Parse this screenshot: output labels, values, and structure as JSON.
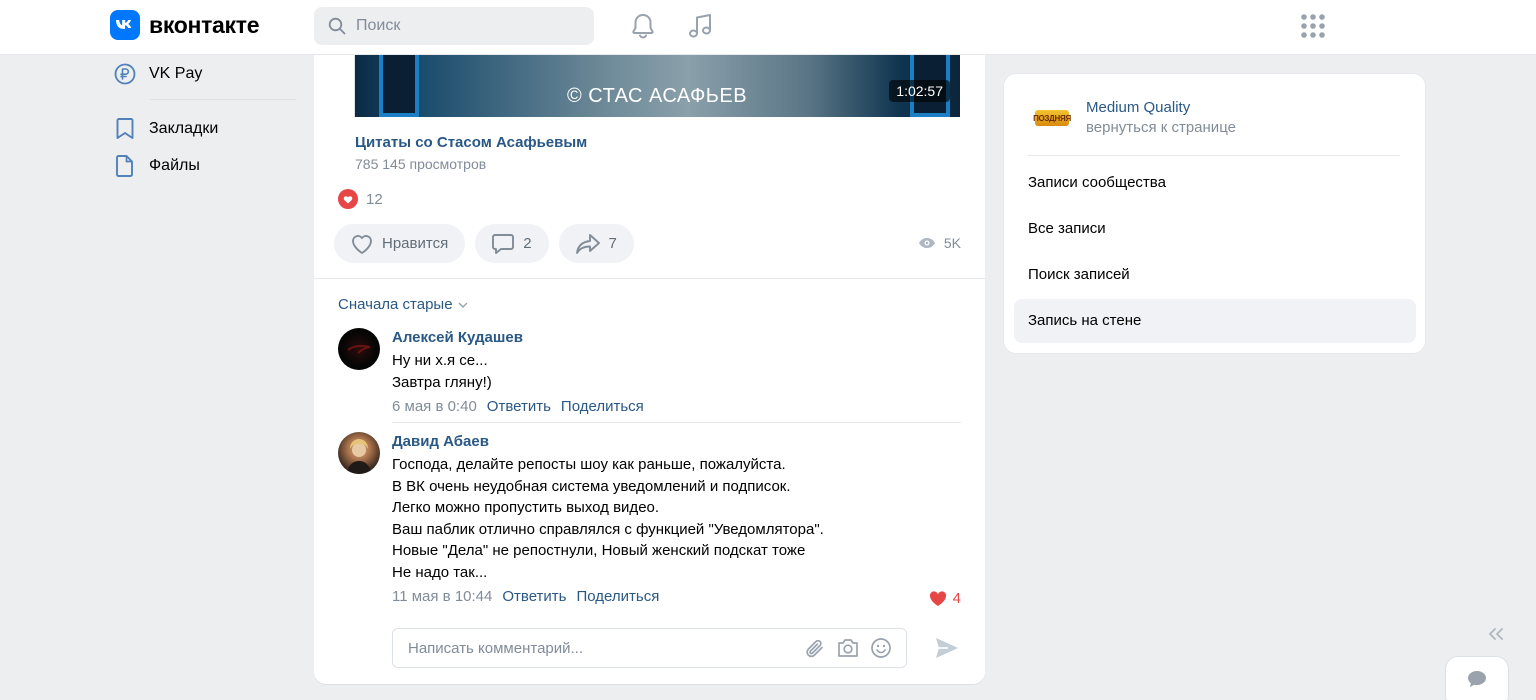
{
  "header": {
    "logo_text": "вконтакте",
    "search_placeholder": "Поиск"
  },
  "left_nav": {
    "items": [
      {
        "label": "VK Pay",
        "icon": "vk-pay-icon"
      },
      {
        "label": "Закладки",
        "icon": "bookmark-icon"
      },
      {
        "label": "Файлы",
        "icon": "file-icon"
      }
    ]
  },
  "post": {
    "video": {
      "credit": "© СТАС АСАФЬЕВ",
      "duration": "1:02:57",
      "title": "Цитаты со Стасом Асафьевым",
      "views": "785 145 просмотров"
    },
    "likes_summary": "12",
    "actions": {
      "like_label": "Нравится",
      "comments_count": "2",
      "shares_count": "7",
      "views_count": "5K"
    },
    "sort_label": "Сначала старые",
    "comments": [
      {
        "author": "Алексей Кудашев",
        "lines": [
          "Ну ни х.я се...",
          "Завтра гляну!)"
        ],
        "time": "6 мая в 0:40",
        "reply_label": "Ответить",
        "share_label": "Поделиться"
      },
      {
        "author": "Давид Абаев",
        "lines": [
          "Господа, делайте репосты шоу как раньше, пожалуйста.",
          "В ВК очень неудобная система уведомлений и подписок.",
          "Легко можно пропустить выход видео.",
          "Ваш паблик отлично справлялся с функцией \"Уведомлятора\".",
          "Новые \"Дела\" не репостнули, Новый женский подскат тоже",
          "Не надо так..."
        ],
        "time": "11 мая в 10:44",
        "reply_label": "Ответить",
        "share_label": "Поделиться",
        "likes": "4"
      }
    ],
    "reply_placeholder": "Написать комментарий..."
  },
  "right_card": {
    "group_name": "Medium Quality",
    "group_sub": "вернуться к странице",
    "logo_text": "ПОЗДНЯЯ",
    "menu": [
      {
        "label": "Записи сообщества",
        "active": false
      },
      {
        "label": "Все записи",
        "active": false
      },
      {
        "label": "Поиск записей",
        "active": false
      },
      {
        "label": "Запись на стене",
        "active": true
      }
    ]
  },
  "colors": {
    "accent": "#0077ff",
    "link": "#2a5885",
    "secondary_text": "#818c99",
    "like_red": "#e64646",
    "background": "#edeef0"
  }
}
